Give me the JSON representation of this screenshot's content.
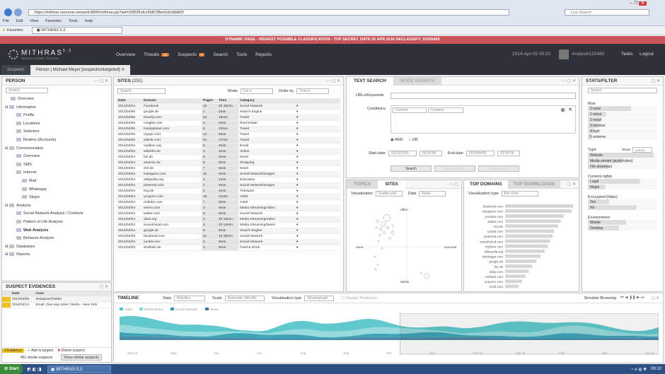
{
  "browser": {
    "url": "https://mithras.nemesis.network:8800/mithras.jsp?aid=03f52fcdccf0d078be0cbc8dd82f",
    "search_placeholder": "Live Search",
    "menu": [
      "File",
      "Edit",
      "View",
      "Favorites",
      "Tools",
      "Help"
    ],
    "favorites": "Favorites",
    "tab": "MITHRAS 5.3"
  },
  "banner": "DYNAMIC PAGE - HIGHEST POSSIBLE CLASSIFICATION - TOP SECRET, DATE 05 APR 2016 DECLASSIFY: 20300405",
  "app": {
    "logo": "MITHRAS",
    "version": "5.3",
    "subtitle": "MASSIVE INTERNET TRACKING",
    "nav": [
      {
        "label": "Overview"
      },
      {
        "label": "Threats",
        "badge": "22"
      },
      {
        "label": "Suspects",
        "badge": "8"
      },
      {
        "label": "Search"
      },
      {
        "label": "Tools"
      },
      {
        "label": "Reports"
      }
    ],
    "date": "2014-Apr-05 09:10",
    "user": "Analyst#125482",
    "tasks": "Tasks",
    "logout": "Logout"
  },
  "tabs": [
    "Suspects",
    "Person | Michael Meyer [suspect/untargeted]"
  ],
  "person": {
    "title": "PERSON",
    "search": "Search",
    "tree": [
      {
        "label": "Overview",
        "lvl": 1
      },
      {
        "label": "Information",
        "lvl": 0
      },
      {
        "label": "Profile",
        "lvl": 2
      },
      {
        "label": "Locations",
        "lvl": 2
      },
      {
        "label": "Selectors",
        "lvl": 2
      },
      {
        "label": "Realms (Accounts)",
        "lvl": 2
      },
      {
        "label": "Communication",
        "lvl": 0
      },
      {
        "label": "Overview",
        "lvl": 2
      },
      {
        "label": "SMS",
        "lvl": 2
      },
      {
        "label": "Internet",
        "lvl": 2
      },
      {
        "label": "Mail",
        "lvl": 3
      },
      {
        "label": "Whatsapp",
        "lvl": 3
      },
      {
        "label": "Skype",
        "lvl": 3
      },
      {
        "label": "Analysis",
        "lvl": 0
      },
      {
        "label": "Social Network Analysis / Contacts",
        "lvl": 2
      },
      {
        "label": "Pattern of Life Analysis",
        "lvl": 2
      },
      {
        "label": "Web Analysis",
        "lvl": 2,
        "bold": true
      },
      {
        "label": "Behavior Analysis",
        "lvl": 2
      },
      {
        "label": "Databases",
        "lvl": 0
      },
      {
        "label": "Reports",
        "lvl": 0
      }
    ]
  },
  "evidences": {
    "title": "SUSPECT EVIDENCES",
    "cols": [
      "Date",
      "Case"
    ],
    "rows": [
      [
        "2014/04/05",
        "Instagram/Twitter"
      ],
      [
        "2014/03/12",
        "Email: One way ticket / Berlin - New York"
      ]
    ],
    "count": "2 Evidence",
    "add": "Add to targets",
    "delete": "Delete suspect",
    "similar": "451 similar suspects",
    "show_similar": "Show similar suspects"
  },
  "sites": {
    "title": "SITES",
    "count": "(251)",
    "search": "Search",
    "mode_label": "Mode",
    "mode": "List",
    "order_label": "Order by",
    "order": "Time",
    "cols": [
      "Date",
      "Domain",
      "Pages",
      "Time",
      "Category"
    ],
    "rows": [
      [
        "2014/04/04",
        "Facebook",
        "12",
        "2h 45min",
        "Social Network"
      ],
      [
        "2014/04/06",
        "google.de",
        "1",
        "2min",
        "Search Engine"
      ],
      [
        "2014/04/06",
        "travelry.com",
        "24",
        "18min",
        "Travel"
      ],
      [
        "2014/04/06",
        "craiglist.com",
        "2",
        "2min",
        "Real Estate"
      ],
      [
        "2014/04/06",
        "lonelyplanet.com",
        "6",
        "23min",
        "Travel"
      ],
      [
        "2014/04/06",
        "myrge.com",
        "14",
        "5min",
        "Travel"
      ],
      [
        "2014/04/06",
        "airbnb.com",
        "21",
        "27min",
        "Travel"
      ],
      [
        "2014/04/04",
        "mailbox.org",
        "5",
        "2min",
        "Email"
      ],
      [
        "2014/04/04",
        "airberlin.de",
        "3",
        "4min",
        "Airline"
      ],
      [
        "2014/04/04",
        "faz.de",
        "5",
        "3min",
        "News"
      ],
      [
        "2014/04/04",
        "amazon.de",
        "8",
        "8min",
        "Shopping"
      ],
      [
        "2014/04/04",
        "zeit.de",
        "7",
        "5min",
        "News"
      ],
      [
        "2014/04/04",
        "instagram.com",
        "31",
        "6min",
        "Social Network/Images"
      ],
      [
        "2014/04/04",
        "wikipedia.org",
        "2",
        "1min",
        "Education"
      ],
      [
        "2014/04/04",
        "pinterest.com",
        "2",
        "6min",
        "Social Network/Images"
      ],
      [
        "2014/04/04",
        "bvg.de",
        "2",
        "4min",
        "Transport"
      ],
      [
        "2014/04/04",
        "youporn.com",
        "18",
        "21min",
        "Adult"
      ],
      [
        "2014/04/04",
        "redtube.com",
        "7",
        "6min",
        "Adult"
      ],
      [
        "2014/04/04",
        "vimeo.com",
        "3",
        "5min",
        "Media Streaming/Video"
      ],
      [
        "2014/04/04",
        "twitter.com",
        "8",
        "5min",
        "Social Network"
      ],
      [
        "2014/04/04",
        "altus.org",
        "3",
        "2h 18min",
        "Media Streaming/Video"
      ],
      [
        "2014/04/04",
        "soundcloud.com",
        "3",
        "1h 12min",
        "Media Streaming/Music"
      ],
      [
        "2014/04/04",
        "google.de",
        "8",
        "6min",
        "Search Engine"
      ],
      [
        "2014/04/03",
        "facebook.com",
        "11",
        "1h 35min",
        "Social Network"
      ],
      [
        "2014/04/03",
        "tumblr.com",
        "3",
        "6min",
        "Social Network"
      ],
      [
        "2014/04/03",
        "sheflash.de",
        "3",
        "8min",
        "Food & Drink"
      ]
    ]
  },
  "textsearch": {
    "tabs": [
      "TEXT SEARCH",
      "NODE SEARCH"
    ],
    "url_label": "URLs/Keywords",
    "cond_label": "Conditions",
    "cond_ph1": "Content",
    "cond_ph2": "contains",
    "and": "AND",
    "or": "OR",
    "start_label": "Start date",
    "start_date": "2013/10/05",
    "start_time": "00:00:00",
    "end_label": "End date",
    "end_date": "2014/04/05",
    "end_time": "23:59:59",
    "search": "Search",
    "b2": "Save search",
    "b3": "Clear search"
  },
  "topics": {
    "tabs": [
      "TOPICS",
      "SITES"
    ],
    "vis_label": "Visualisation",
    "vis": "Scatter plot",
    "data_label": "Data",
    "data": "Risks",
    "axes": {
      "top": "often",
      "bottom": "rarely",
      "left": "none",
      "right": "extreme"
    }
  },
  "domains": {
    "tabs": [
      "TOP DOMAINS",
      "TOP DOWNLOADS"
    ],
    "vis_label": "Visualisation type",
    "vis": "Bar chart"
  },
  "chart_data": {
    "type": "bar",
    "categories": [
      "facebook.com",
      "instagram.com",
      "youtube.com",
      "twitter.com",
      "zeit.de",
      "tumblr.com",
      "pinterest.com",
      "soundcloud.com",
      "mylinen.com",
      "wikipedia.org",
      "vbsrlagge.com",
      "google.de",
      "faz.de",
      "ebay.com",
      "redtube.com",
      "youporn.com",
      "xnxb.com"
    ],
    "values": [
      100,
      98,
      86,
      82,
      78,
      72,
      70,
      66,
      63,
      58,
      52,
      46,
      40,
      35,
      30,
      25,
      20
    ],
    "xlim": [
      0,
      100
    ]
  },
  "stats": {
    "title": "STATS/FILTER",
    "search": "Search",
    "risk_label": "Risk",
    "risk": [
      "0 none",
      "1 minor",
      "2 small",
      "3 medium",
      "4 high",
      "5 extreme"
    ],
    "risk_levels": [
      0.62,
      0.26,
      0.18,
      0.15,
      0.09,
      0.05
    ],
    "type_label": "Type",
    "show_label": "Show",
    "show": "activity",
    "types": [
      "Website",
      "Media stream (audio/video)",
      "File download"
    ],
    "type_levels": [
      0.95,
      0.5,
      0.3
    ],
    "cr_label": "Content rights",
    "cr": [
      "Legal",
      "Illegal"
    ],
    "cr_levels": [
      0.75,
      0.25
    ],
    "enc_label": "Encrypted (https)",
    "enc": [
      "Yes",
      "No"
    ],
    "enc_levels": [
      0.3,
      0.7
    ],
    "env_label": "Environment",
    "env": [
      "Mobile",
      "Desktop"
    ],
    "env_levels": [
      0.55,
      0.45
    ]
  },
  "timeline": {
    "title": "TIMELINE",
    "data_label": "Data",
    "data": "Activities",
    "scale_label": "Scale",
    "scale": "Automatic (Month)",
    "vis_label": "Visualisation type",
    "vis": "Streamgraph",
    "display_pred": "Display Prediction",
    "simulate": "Simulate Browsing",
    "legend": [
      "Adult",
      "Web/Culture",
      "Social Network",
      "News"
    ],
    "months": [
      "Mar 13",
      "May",
      "Jun",
      "Jul",
      "Aug",
      "Sep",
      "Oct",
      "Nov",
      "Dec 13",
      "Jan 14",
      "Feb",
      "Mar",
      "Apr 14"
    ],
    "colors": [
      "#4fc3c8",
      "#8dd7da",
      "#2a9ab0",
      "#3a7f9e"
    ]
  },
  "taskbar": {
    "start": "Start",
    "app": "MITHRAS 5.3",
    "clock": "09:10"
  }
}
